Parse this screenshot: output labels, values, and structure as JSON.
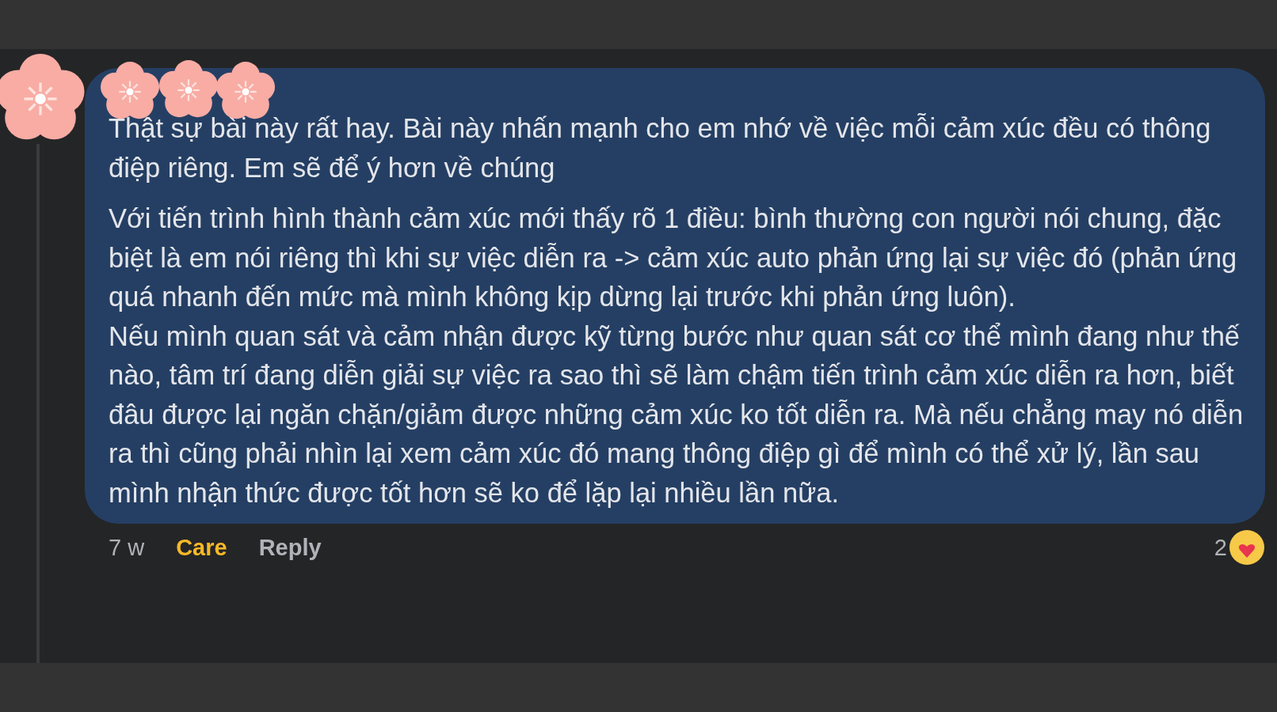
{
  "comment": {
    "paragraphs": [
      [
        "Thật sự bài này rất hay. Bài này nhấn mạnh cho em nhớ về việc mỗi cảm xúc đều có thông điệp riêng. Em sẽ để ý hơn về chúng"
      ],
      [
        "Với tiến trình hình thành cảm xúc mới thấy rõ 1 điều: bình thường con người nói chung, đặc biệt là em nói riêng thì khi sự việc diễn ra -> cảm xúc auto phản ứng lại sự việc đó (phản ứng quá nhanh đến mức mà mình không kịp dừng lại trước khi phản ứng luôn).",
        "Nếu mình quan sát và cảm nhận được kỹ từng bước như quan sát cơ thể mình đang như thế nào, tâm trí đang diễn giải sự việc ra sao thì sẽ làm chậm tiến trình cảm xúc diễn ra hơn, biết đâu được lại ngăn chặn/giảm được những cảm xúc ko tốt diễn ra. Mà nếu chẳng may nó diễn ra thì cũng phải nhìn lại xem cảm xúc đó mang thông điệp gì để mình có thể xử lý, lần sau mình nhận thức được tốt hơn sẽ ko để lặp lại nhiều lần nữa."
      ]
    ]
  },
  "footer": {
    "time": "7 w",
    "reaction": "Care",
    "reaction_selected": true,
    "reply": "Reply",
    "reaction_count": "2"
  }
}
